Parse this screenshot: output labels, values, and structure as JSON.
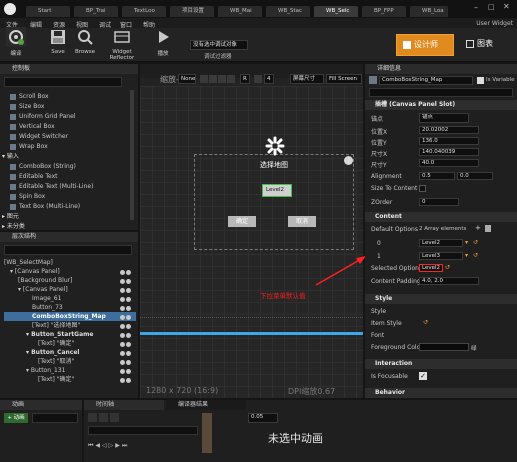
{
  "tabs": [
    {
      "label": "Start",
      "active": false
    },
    {
      "label": "BP_Trai",
      "active": false
    },
    {
      "label": "TextLoo",
      "active": false
    },
    {
      "label": "项目设置",
      "active": false
    },
    {
      "label": "WB_Mai",
      "active": false
    },
    {
      "label": "WB_Stac",
      "active": false
    },
    {
      "label": "WB_Selc",
      "active": true
    },
    {
      "label": "BP_FPP",
      "active": false
    },
    {
      "label": "WB_Loa",
      "active": false
    }
  ],
  "window": {
    "user_widget": "User Widget"
  },
  "menu": [
    "文件",
    "编辑",
    "资源",
    "视图",
    "调试",
    "窗口",
    "帮助"
  ],
  "toolbar": {
    "compile": "编译",
    "save": "Save",
    "browse": "Browse",
    "widget_reflector": "Widget Reflector",
    "play": "播放",
    "debug_object": "没有选中调试对象",
    "debug_filter": "调试过滤器",
    "designer": "设计师",
    "graph": "图表"
  },
  "palette": {
    "title": "控制板",
    "items": [
      "Scroll Box",
      "Size Box",
      "Uniform Grid Panel",
      "Vertical Box",
      "Widget Switcher",
      "Wrap Box"
    ],
    "input_header": "输入",
    "input_items": [
      "ComboBox (String)",
      "Editable Text",
      "Editable Text (Multi-Line)",
      "Spin Box",
      "Text Box (Multi-Line)"
    ],
    "primitive": "图元",
    "uncategorized": "未分类"
  },
  "hierarchy": {
    "title": "层次结构",
    "items": [
      "[WB_SelectMap]",
      "[Canvas Panel]",
      "[Background Blur]",
      "[Canvas Panel]",
      "Image_61",
      "Button_73",
      "ComboBoxString_Map",
      "[Text] \"选择地图\"",
      "Button_StartGame",
      "[Text] \"确定\"",
      "Button_Cancel",
      "[Text] \"取消\"",
      "Button_131",
      "[Text] \"确定\""
    ]
  },
  "viewport": {
    "zoom": "缩放-2",
    "none_btn": "None",
    "r_label": "R",
    "snap": "4",
    "screen_size": "屏幕尺寸",
    "fill_screen": "Fill Screen",
    "resolution": "1280 x 720 (16:9)",
    "dpi": "DPI缩放0.67",
    "title_text": "选择地图",
    "combo_value": "Level2",
    "confirm_btn": "确定",
    "cancel_btn": "取消",
    "annotation": "下拉菜单默认值"
  },
  "details": {
    "title": "详细信息",
    "name_value": "ComboBoxString_Map",
    "is_variable": "Is Variable",
    "slot_header": "插槽 (Canvas Panel Slot)",
    "anchor_label": "锚点",
    "anchor_value": "锚点",
    "pos_x_label": "位置X",
    "pos_x_value": "20.02002",
    "pos_y_label": "位置Y",
    "pos_y_value": "136.0",
    "size_x_label": "尺寸X",
    "size_x_value": "140.040039",
    "size_y_label": "尺寸Y",
    "size_y_value": "40.0",
    "alignment_label": "Alignment",
    "align_x": "0.5",
    "align_y": "0.0",
    "size_to_content": "Size To Content",
    "zorder_label": "ZOrder",
    "zorder_value": "0",
    "content_header": "Content",
    "default_options_label": "Default Options",
    "default_options_value": "2 Array elements",
    "opt0_index": "0",
    "opt0_value": "Level2",
    "opt1_index": "1",
    "opt1_value": "Level3",
    "selected_option_label": "Selected Option",
    "selected_option_value": "Level2",
    "content_padding_label": "Content Padding",
    "content_padding_value": "4.0, 2.0",
    "style_header": "Style",
    "style_label": "Style",
    "item_style_label": "Item Style",
    "font_label": "Font",
    "foreground_label": "Foreground Color",
    "foreground_value": "绿",
    "interaction_header": "Interaction",
    "is_focusable": "Is Focusable",
    "behavior_header": "Behavior"
  },
  "bottom": {
    "animation_title": "动画",
    "add_btn": "+ 动画",
    "timeline_tab": "时间轴",
    "compiler_tab": "编译器结果",
    "time_value": "0.05",
    "no_animation": "未选中动画"
  },
  "colors": {
    "accent": "#f0a030",
    "selection": "#3d6e9e",
    "annotation": "#ff2020"
  }
}
